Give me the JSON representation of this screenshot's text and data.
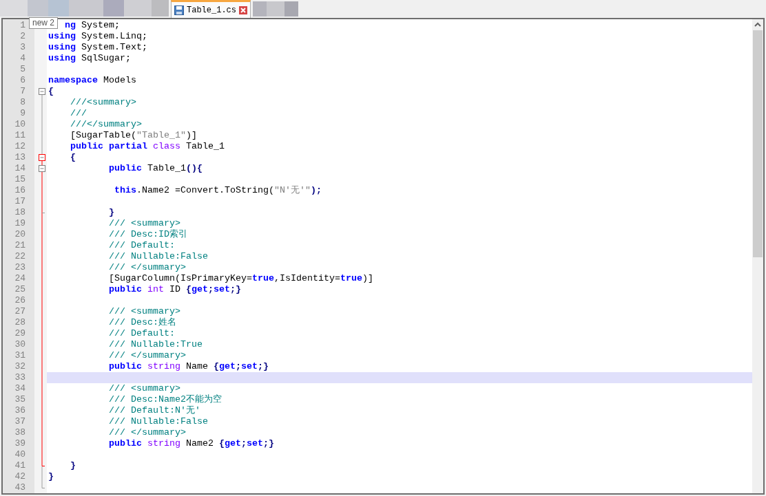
{
  "tabs": [
    {
      "label": "Table_1.cs",
      "selected": true
    }
  ],
  "tooltip": "new 2",
  "lines": [
    {
      "number": "1",
      "kind": "none",
      "current": false,
      "tokens": [
        {
          "kind": "keyword",
          "text": "ng"
        },
        {
          "kind": "plain",
          "text": " System;"
        }
      ]
    },
    {
      "number": "2",
      "kind": "none",
      "current": false,
      "tokens": [
        {
          "kind": "keyword",
          "text": "using"
        },
        {
          "kind": "plain",
          "text": " System.Linq;"
        }
      ]
    },
    {
      "number": "3",
      "kind": "none",
      "current": false,
      "tokens": [
        {
          "kind": "keyword",
          "text": "using"
        },
        {
          "kind": "plain",
          "text": " System.Text;"
        }
      ]
    },
    {
      "number": "4",
      "kind": "none",
      "current": false,
      "tokens": [
        {
          "kind": "keyword",
          "text": "using"
        },
        {
          "kind": "plain",
          "text": " SqlSugar;"
        }
      ]
    },
    {
      "number": "5",
      "kind": "none",
      "current": false
    },
    {
      "number": "6",
      "kind": "none",
      "current": false,
      "tokens": [
        {
          "kind": "keyword",
          "text": "namespace"
        },
        {
          "kind": "plain",
          "text": " Models"
        }
      ]
    },
    {
      "number": "7",
      "kind": "open",
      "current": false,
      "tokens": [
        {
          "kind": "operator",
          "text": "{"
        }
      ]
    },
    {
      "number": "8",
      "kind": "line",
      "current": false,
      "tokens": [
        {
          "kind": "comment",
          "text": "    ///<summary>"
        }
      ]
    },
    {
      "number": "9",
      "kind": "line",
      "current": false,
      "tokens": [
        {
          "kind": "comment",
          "text": "    ///"
        }
      ]
    },
    {
      "number": "10",
      "kind": "line",
      "current": false,
      "tokens": [
        {
          "kind": "comment",
          "text": "    ///</summary>"
        }
      ]
    },
    {
      "number": "11",
      "kind": "line",
      "current": false,
      "tokens": [
        {
          "kind": "plain",
          "text": "    [SugarTable("
        },
        {
          "kind": "string",
          "text": "\"Table_1\""
        },
        {
          "kind": "plain",
          "text": ")]"
        }
      ]
    },
    {
      "number": "12",
      "kind": "line",
      "current": false,
      "tokens": [
        {
          "kind": "keyword",
          "text": "    public partial"
        },
        {
          "kind": "type",
          "text": " class"
        },
        {
          "kind": "plain",
          "text": " Table_1"
        }
      ]
    },
    {
      "number": "13",
      "kind": "open-active",
      "current": false,
      "tokens": [
        {
          "kind": "operator",
          "text": "    {"
        }
      ]
    },
    {
      "number": "14",
      "kind": "open-nested",
      "current": false,
      "tokens": [
        {
          "kind": "keyword",
          "text": "           public"
        },
        {
          "kind": "plain",
          "text": " Table_1"
        },
        {
          "kind": "operator",
          "text": "(){"
        }
      ]
    },
    {
      "number": "15",
      "kind": "active",
      "current": false
    },
    {
      "number": "16",
      "kind": "active",
      "current": false,
      "tokens": [
        {
          "kind": "keyword",
          "text": "            this"
        },
        {
          "kind": "plain",
          "text": ".Name2 =Convert.ToString("
        },
        {
          "kind": "string",
          "text": "\"N'无'\""
        },
        {
          "kind": "operator",
          "text": ");"
        }
      ]
    },
    {
      "number": "17",
      "kind": "active",
      "current": false
    },
    {
      "number": "18",
      "kind": "end-nested",
      "current": false,
      "tokens": [
        {
          "kind": "operator",
          "text": "           }"
        }
      ]
    },
    {
      "number": "19",
      "kind": "active",
      "current": false,
      "tokens": [
        {
          "kind": "comment",
          "text": "           /// <summary>"
        }
      ]
    },
    {
      "number": "20",
      "kind": "active",
      "current": false,
      "tokens": [
        {
          "kind": "comment",
          "text": "           /// Desc:ID索引"
        }
      ]
    },
    {
      "number": "21",
      "kind": "active",
      "current": false,
      "tokens": [
        {
          "kind": "comment",
          "text": "           /// Default:"
        }
      ]
    },
    {
      "number": "22",
      "kind": "active",
      "current": false,
      "tokens": [
        {
          "kind": "comment",
          "text": "           /// Nullable:False"
        }
      ]
    },
    {
      "number": "23",
      "kind": "active",
      "current": false,
      "tokens": [
        {
          "kind": "comment",
          "text": "           /// </summary>"
        }
      ]
    },
    {
      "number": "24",
      "kind": "active",
      "current": false,
      "tokens": [
        {
          "kind": "plain",
          "text": "           [SugarColumn(IsPrimaryKey="
        },
        {
          "kind": "keyword",
          "text": "true"
        },
        {
          "kind": "plain",
          "text": ",IsIdentity="
        },
        {
          "kind": "keyword",
          "text": "true"
        },
        {
          "kind": "plain",
          "text": ")]"
        }
      ]
    },
    {
      "number": "25",
      "kind": "active",
      "current": false,
      "tokens": [
        {
          "kind": "keyword",
          "text": "           public"
        },
        {
          "kind": "type",
          "text": " int"
        },
        {
          "kind": "plain",
          "text": " ID "
        },
        {
          "kind": "operator",
          "text": "{"
        },
        {
          "kind": "keyword",
          "text": "get"
        },
        {
          "kind": "operator",
          "text": ";"
        },
        {
          "kind": "keyword",
          "text": "set"
        },
        {
          "kind": "operator",
          "text": ";}"
        }
      ]
    },
    {
      "number": "26",
      "kind": "active",
      "current": false
    },
    {
      "number": "27",
      "kind": "active",
      "current": false,
      "tokens": [
        {
          "kind": "comment",
          "text": "           /// <summary>"
        }
      ]
    },
    {
      "number": "28",
      "kind": "active",
      "current": false,
      "tokens": [
        {
          "kind": "comment",
          "text": "           /// Desc:姓名"
        }
      ]
    },
    {
      "number": "29",
      "kind": "active",
      "current": false,
      "tokens": [
        {
          "kind": "comment",
          "text": "           /// Default:"
        }
      ]
    },
    {
      "number": "30",
      "kind": "active",
      "current": false,
      "tokens": [
        {
          "kind": "comment",
          "text": "           /// Nullable:True"
        }
      ]
    },
    {
      "number": "31",
      "kind": "active",
      "current": false,
      "tokens": [
        {
          "kind": "comment",
          "text": "           /// </summary>"
        }
      ]
    },
    {
      "number": "32",
      "kind": "active",
      "current": false,
      "tokens": [
        {
          "kind": "keyword",
          "text": "           public"
        },
        {
          "kind": "type",
          "text": " string"
        },
        {
          "kind": "plain",
          "text": " Name "
        },
        {
          "kind": "operator",
          "text": "{"
        },
        {
          "kind": "keyword",
          "text": "get"
        },
        {
          "kind": "operator",
          "text": ";"
        },
        {
          "kind": "keyword",
          "text": "set"
        },
        {
          "kind": "operator",
          "text": ";}"
        }
      ]
    },
    {
      "number": "33",
      "kind": "active",
      "current": true
    },
    {
      "number": "34",
      "kind": "active",
      "current": false,
      "tokens": [
        {
          "kind": "comment",
          "text": "           /// <summary>"
        }
      ]
    },
    {
      "number": "35",
      "kind": "active",
      "current": false,
      "tokens": [
        {
          "kind": "comment",
          "text": "           /// Desc:Name2不能为空"
        }
      ]
    },
    {
      "number": "36",
      "kind": "active",
      "current": false,
      "tokens": [
        {
          "kind": "comment",
          "text": "           /// Default:N'无'"
        }
      ]
    },
    {
      "number": "37",
      "kind": "active",
      "current": false,
      "tokens": [
        {
          "kind": "comment",
          "text": "           /// Nullable:False"
        }
      ]
    },
    {
      "number": "38",
      "kind": "active",
      "current": false,
      "tokens": [
        {
          "kind": "comment",
          "text": "           /// </summary>"
        }
      ]
    },
    {
      "number": "39",
      "kind": "active",
      "current": false,
      "tokens": [
        {
          "kind": "keyword",
          "text": "           public"
        },
        {
          "kind": "type",
          "text": " string"
        },
        {
          "kind": "plain",
          "text": " Name2 "
        },
        {
          "kind": "operator",
          "text": "{"
        },
        {
          "kind": "keyword",
          "text": "get"
        },
        {
          "kind": "operator",
          "text": ";"
        },
        {
          "kind": "keyword",
          "text": "set"
        },
        {
          "kind": "operator",
          "text": ";}"
        }
      ]
    },
    {
      "number": "40",
      "kind": "active",
      "current": false
    },
    {
      "number": "41",
      "kind": "end-active",
      "current": false,
      "tokens": [
        {
          "kind": "operator",
          "text": "    }"
        }
      ]
    },
    {
      "number": "42",
      "kind": "line",
      "current": false,
      "tokens": [
        {
          "kind": "operator",
          "text": "}"
        }
      ]
    },
    {
      "number": "43",
      "kind": "end",
      "current": false
    }
  ]
}
